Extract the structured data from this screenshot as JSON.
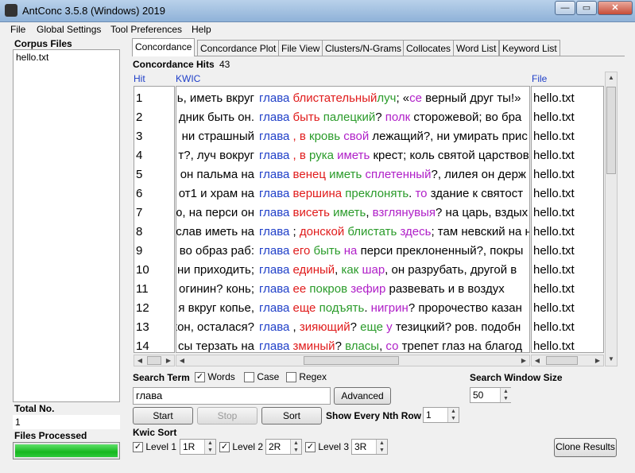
{
  "window": {
    "title": "AntConc 3.5.8 (Windows) 2019",
    "minimize": "—",
    "maximize": "▭",
    "close": "✕"
  },
  "menu": [
    "File",
    "Global Settings",
    "Tool Preferences",
    "Help"
  ],
  "sidebar": {
    "corpus_files_label": "Corpus Files",
    "files": [
      "hello.txt"
    ],
    "total_no_label": "Total No.",
    "total_no": "1",
    "files_processed_label": "Files Processed",
    "progress": 1.0
  },
  "tabs": [
    "Concordance",
    "Concordance Plot",
    "File View",
    "Clusters/N-Grams",
    "Collocates",
    "Word List",
    "Keyword List"
  ],
  "active_tab": "Concordance",
  "concordance": {
    "hits_label": "Concordance Hits",
    "hits_count": "43",
    "col_hit": "Hit",
    "col_kwic": "KWIC",
    "col_file": "File",
    "rows": [
      {
        "n": "1",
        "left": "ь, иметь вкруг",
        "kw": "глава",
        "parts": [
          [
            "blistatelnyy",
            "#e01b1b",
            "блистательный"
          ],
          [
            "",
            "#2a9b2a",
            "луч"
          ],
          [
            "",
            "#000",
            ";"
          ],
          [
            "",
            "#000",
            " «"
          ],
          [
            "",
            "#b020c8",
            "се"
          ],
          [
            "",
            "#000",
            " верный друг ты!»"
          ]
        ]
      },
      {
        "n": "2",
        "left": "дник быть он.",
        "kw": "глава",
        "parts": [
          [
            "",
            "#e01b1b",
            "быть"
          ],
          [
            "",
            "#2a9b2a",
            " палецкий"
          ],
          [
            "",
            "#000",
            "?"
          ],
          [
            "",
            "#b020c8",
            " полк"
          ],
          [
            "",
            "#000",
            " сторожевой; во бра"
          ]
        ]
      },
      {
        "n": "3",
        "left": "ни страшный",
        "kw": "глава",
        "parts": [
          [
            "",
            "#e01b1b",
            ", в"
          ],
          [
            "",
            "#2a9b2a",
            " кровь"
          ],
          [
            "",
            "#b020c8",
            " свой"
          ],
          [
            "",
            "#000",
            " лежащий?, ни умирать прис"
          ]
        ]
      },
      {
        "n": "4",
        "left": "т?, луч вокруг",
        "kw": "глава",
        "parts": [
          [
            "",
            "#e01b1b",
            ", в"
          ],
          [
            "",
            "#2a9b2a",
            " рука"
          ],
          [
            "",
            "#b020c8",
            " иметь"
          ],
          [
            "",
            "#000",
            " крест; коль святой царствов"
          ]
        ]
      },
      {
        "n": "5",
        "left": "он пальма на",
        "kw": "глава",
        "parts": [
          [
            "",
            "#e01b1b",
            "венец"
          ],
          [
            "",
            "#2a9b2a",
            " иметь"
          ],
          [
            "",
            "#b020c8",
            " сплетенный"
          ],
          [
            "",
            "#000",
            "?, лилея он держ"
          ]
        ]
      },
      {
        "n": "6",
        "left": "от1 и храм на",
        "kw": "глава",
        "parts": [
          [
            "",
            "#e01b1b",
            "вершина"
          ],
          [
            "",
            "#2a9b2a",
            " преклонять"
          ],
          [
            "",
            "#000",
            "."
          ],
          [
            "",
            "#b020c8",
            " то"
          ],
          [
            "",
            "#000",
            " здание к святост"
          ]
        ]
      },
      {
        "n": "7",
        "left": "ю, на перси он",
        "kw": "глава",
        "parts": [
          [
            "",
            "#e01b1b",
            "висеть"
          ],
          [
            "",
            "#2a9b2a",
            " иметь"
          ],
          [
            "",
            "#000",
            ","
          ],
          [
            "",
            "#b020c8",
            " взглянувыя"
          ],
          [
            "",
            "#000",
            "? на царь, вздых"
          ]
        ]
      },
      {
        "n": "8",
        "left": "слав иметь на",
        "kw": "глава",
        "parts": [
          [
            "",
            "#000",
            ";"
          ],
          [
            "",
            "#e01b1b",
            " донской"
          ],
          [
            "",
            "#2a9b2a",
            " блистать"
          ],
          [
            "",
            "#b020c8",
            " здесь"
          ],
          [
            "",
            "#000",
            "; там невский на н"
          ]
        ]
      },
      {
        "n": "9",
        "left": "во образ раб:",
        "kw": "глава",
        "parts": [
          [
            "",
            "#e01b1b",
            "его"
          ],
          [
            "",
            "#2a9b2a",
            " быть"
          ],
          [
            "",
            "#b020c8",
            " на"
          ],
          [
            "",
            "#000",
            " перси преклоненный?, покры"
          ]
        ]
      },
      {
        "n": "10",
        "left": "ни приходить;",
        "kw": "глава",
        "parts": [
          [
            "",
            "#e01b1b",
            "единый"
          ],
          [
            "",
            "#000",
            ","
          ],
          [
            "",
            "#2a9b2a",
            " как"
          ],
          [
            "",
            "#b020c8",
            " шар"
          ],
          [
            "",
            "#000",
            ", он разрубать, другой в"
          ]
        ]
      },
      {
        "n": "11",
        "left": "огинин? конь;",
        "kw": "глава",
        "parts": [
          [
            "",
            "#e01b1b",
            "ее"
          ],
          [
            "",
            "#2a9b2a",
            " покров"
          ],
          [
            "",
            "#b020c8",
            " зефир"
          ],
          [
            "",
            "#000",
            " развевать и в воздух"
          ]
        ]
      },
      {
        "n": "12",
        "left": "я вкруг копье,",
        "kw": "глава",
        "parts": [
          [
            "",
            "#e01b1b",
            "еще"
          ],
          [
            "",
            "#2a9b2a",
            " подъять"
          ],
          [
            "",
            "#000",
            "."
          ],
          [
            "",
            "#b020c8",
            " нигрин"
          ],
          [
            "",
            "#000",
            "? пророчество казан"
          ]
        ]
      },
      {
        "n": "13",
        "left": "кон, осталася?",
        "kw": "глава",
        "parts": [
          [
            "",
            "#000",
            ","
          ],
          [
            "",
            "#e01b1b",
            " зияющий"
          ],
          [
            "",
            "#000",
            "?"
          ],
          [
            "",
            "#2a9b2a",
            " еще"
          ],
          [
            "",
            "#b020c8",
            " у"
          ],
          [
            "",
            "#000",
            " тезицкий? ров. подобн"
          ]
        ]
      },
      {
        "n": "14",
        "left": "сы терзать на",
        "kw": "глава",
        "parts": [
          [
            "",
            "#e01b1b",
            "зминый"
          ],
          [
            "",
            "#000",
            "?"
          ],
          [
            "",
            "#2a9b2a",
            " власы"
          ],
          [
            "",
            "#000",
            ","
          ],
          [
            "",
            "#b020c8",
            " со"
          ],
          [
            "",
            "#000",
            " трепет глаз на благод"
          ]
        ]
      }
    ],
    "file_name": "hello.txt"
  },
  "search": {
    "term_label": "Search Term",
    "words_label": "Words",
    "words_checked": true,
    "case_label": "Case",
    "case_checked": false,
    "regex_label": "Regex",
    "regex_checked": false,
    "query": "глава",
    "advanced": "Advanced",
    "window_size_label": "Search Window Size",
    "window_size": "50"
  },
  "controls": {
    "start": "Start",
    "stop": "Stop",
    "sort": "Sort",
    "nth_row_label": "Show Every Nth Row",
    "nth_row": "1",
    "kwic_sort_label": "Kwic Sort",
    "levels": [
      {
        "label": "Level 1",
        "value": "1R"
      },
      {
        "label": "Level 2",
        "value": "2R"
      },
      {
        "label": "Level 3",
        "value": "3R"
      }
    ],
    "clone": "Clone Results"
  },
  "colors": {
    "kw": "#1f3fc8",
    "left": "#e01b1b",
    "mid": "#2a9b2a",
    "right": "#b020c8",
    "progress": "#17b81f"
  }
}
